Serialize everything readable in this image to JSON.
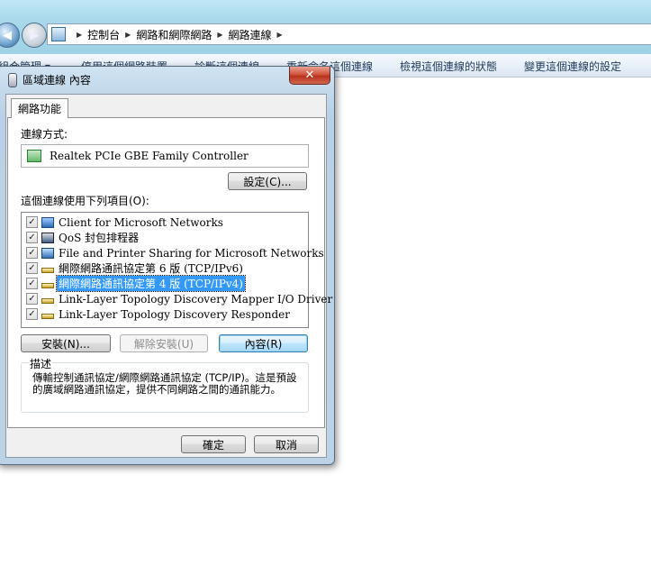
{
  "explorer": {
    "breadcrumbs": [
      "控制台",
      "網路和網際網路",
      "網路連線"
    ],
    "commands": [
      "組合管理 ▾",
      "停用這個網路裝置",
      "診斷這個連線",
      "重新命名這個連線",
      "檢視這個連線的狀態",
      "變更這個連線的設定"
    ]
  },
  "dialog": {
    "title": "區域連線 內容",
    "close_label": "✕",
    "tab_label": "網路功能",
    "connect_using_label": "連線方式:",
    "adapter_name": "Realtek PCIe GBE Family Controller",
    "configure_button": "設定(C)...",
    "items_label": "這個連線使用下列項目(O):",
    "items": [
      {
        "label": "Client for Microsoft Networks",
        "checked": true,
        "icon": "network-client-icon"
      },
      {
        "label": "QoS 封包排程器",
        "checked": true,
        "icon": "qos-icon"
      },
      {
        "label": "File and Printer Sharing for Microsoft Networks",
        "checked": true,
        "icon": "sharing-icon"
      },
      {
        "label": "網際網路通訊協定第 6 版 (TCP/IPv6)",
        "checked": true,
        "icon": "protocol-icon"
      },
      {
        "label": "網際網路通訊協定第 4 版 (TCP/IPv4)",
        "checked": true,
        "icon": "protocol-icon",
        "selected": true
      },
      {
        "label": "Link-Layer Topology Discovery Mapper I/O Driver",
        "checked": true,
        "icon": "protocol-icon"
      },
      {
        "label": "Link-Layer Topology Discovery Responder",
        "checked": true,
        "icon": "protocol-icon"
      }
    ],
    "install_button": "安裝(N)...",
    "uninstall_button": "解除安裝(U)",
    "properties_button": "內容(R)",
    "description_label": "描述",
    "description_text": "傳輸控制通訊協定/網際網路通訊協定 (TCP/IP)。這是預設的廣域網路通訊協定，提供不同網路之間的通訊能力。",
    "ok_button": "確定",
    "cancel_button": "取消"
  }
}
